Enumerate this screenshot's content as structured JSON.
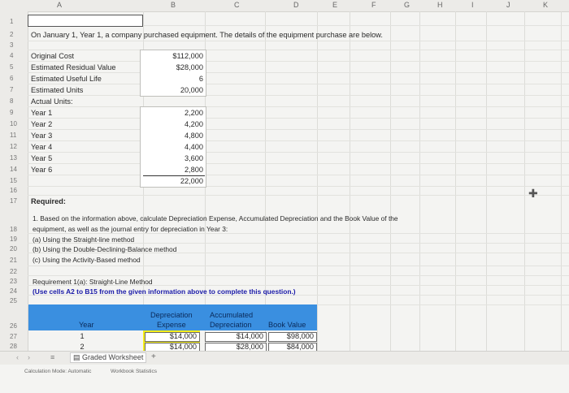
{
  "columns": [
    "A",
    "B",
    "C",
    "D",
    "E",
    "F",
    "G",
    "H",
    "I",
    "J",
    "K"
  ],
  "rows": [
    "1",
    "2",
    "3",
    "4",
    "5",
    "6",
    "7",
    "8",
    "9",
    "10",
    "11",
    "12",
    "13",
    "14",
    "15",
    "16",
    "17",
    "18",
    "19",
    "20",
    "21",
    "22",
    "23",
    "24",
    "25",
    "26",
    "27",
    "28"
  ],
  "text": {
    "r2": "On January 1, Year 1, a company purchased equipment. The details of the equipment purchase are below.",
    "r4": "Original Cost",
    "r5": "Estimated Residual Value",
    "r6": "Estimated Useful Life",
    "r7": "Estimated Units",
    "r8": "Actual Units:",
    "r9": "Year 1",
    "r10": "Year 2",
    "r11": "Year 3",
    "r12": "Year 4",
    "r13": "Year 5",
    "r14": "Year 6",
    "r17": "Required:",
    "r17b": "1. Based on the information above, calculate Depreciation Expense, Accumulated Depreciation and the Book Value of the",
    "r18": "equipment, as well as the journal entry for depreciation in Year 3:",
    "r19": "(a) Using the Straight-line method",
    "r20": "(b) Using the Double-Declining-Balance method",
    "r21": "(c) Using the Activity-Based method",
    "r23": "Requirement 1(a): Straight-Line Method",
    "r24": "(Use cells A2 to B15 from the given information above to complete this question.)"
  },
  "values": {
    "original_cost": "$112,000",
    "residual": "$28,000",
    "useful_life": "6",
    "est_units": "20,000",
    "y1": "2,200",
    "y2": "4,200",
    "y3": "4,800",
    "y4": "4,400",
    "y5": "3,600",
    "y6": "2,800",
    "total": "22,000"
  },
  "table": {
    "h_year": "Year",
    "h_dep": "Depreciation",
    "h_exp": "Expense",
    "h_acc": "Accumulated",
    "h_accdep": "Depreciation",
    "h_book": "Book Value",
    "r1": {
      "year": "1",
      "exp": "$14,000",
      "acc": "$14,000",
      "book": "$98,000"
    },
    "r2": {
      "year": "2",
      "exp": "$14,000",
      "acc": "$28,000",
      "book": "$84,000"
    }
  },
  "tabs": {
    "sheet": "Graded Worksheet",
    "add": "+"
  },
  "status": {
    "calc": "Calculation Mode: Automatic",
    "stats": "Workbook Statistics"
  },
  "colors": {
    "header_band": "#3a8fe0",
    "input_yellow": "#f4ed1a"
  }
}
